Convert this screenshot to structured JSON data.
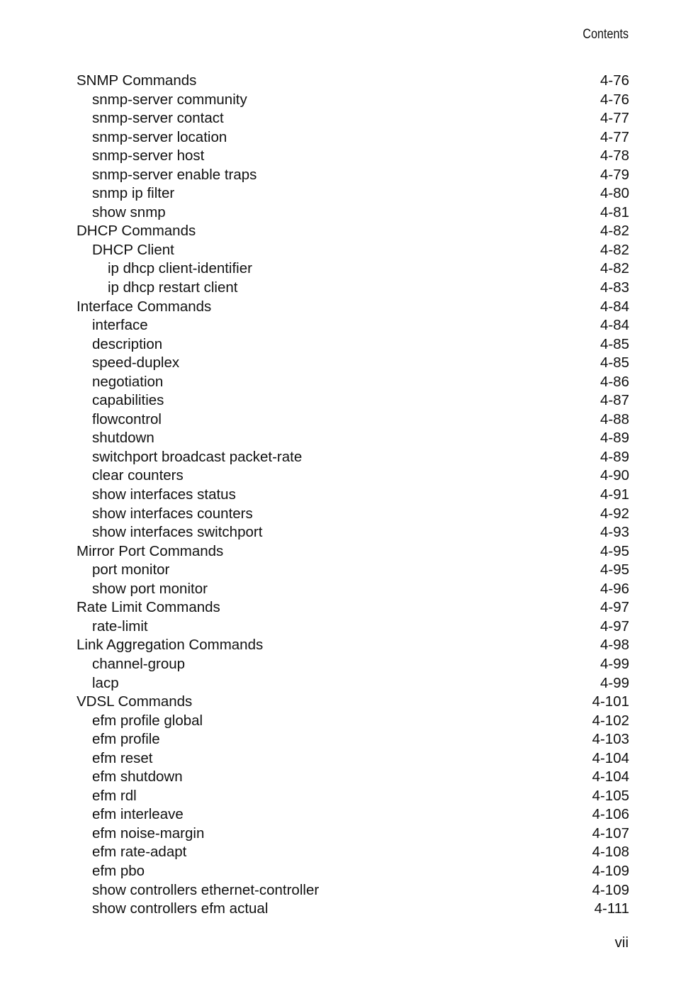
{
  "header": {
    "running_title": "Contents"
  },
  "toc": {
    "entries": [
      {
        "title": "SNMP Commands",
        "page": "4-76",
        "level": 0
      },
      {
        "title": "snmp-server community",
        "page": "4-76",
        "level": 1
      },
      {
        "title": "snmp-server contact",
        "page": "4-77",
        "level": 1
      },
      {
        "title": "snmp-server location",
        "page": "4-77",
        "level": 1
      },
      {
        "title": "snmp-server host",
        "page": "4-78",
        "level": 1
      },
      {
        "title": "snmp-server enable traps",
        "page": "4-79",
        "level": 1
      },
      {
        "title": "snmp ip filter",
        "page": "4-80",
        "level": 1
      },
      {
        "title": "show snmp",
        "page": "4-81",
        "level": 1
      },
      {
        "title": "DHCP Commands",
        "page": "4-82",
        "level": 0
      },
      {
        "title": "DHCP Client",
        "page": "4-82",
        "level": 1
      },
      {
        "title": "ip dhcp client-identifier",
        "page": "4-82",
        "level": 2
      },
      {
        "title": "ip dhcp restart client",
        "page": "4-83",
        "level": 2
      },
      {
        "title": "Interface Commands",
        "page": "4-84",
        "level": 0
      },
      {
        "title": "interface",
        "page": "4-84",
        "level": 1
      },
      {
        "title": "description",
        "page": "4-85",
        "level": 1
      },
      {
        "title": "speed-duplex",
        "page": "4-85",
        "level": 1
      },
      {
        "title": "negotiation",
        "page": "4-86",
        "level": 1
      },
      {
        "title": "capabilities",
        "page": "4-87",
        "level": 1
      },
      {
        "title": "flowcontrol",
        "page": "4-88",
        "level": 1
      },
      {
        "title": "shutdown",
        "page": "4-89",
        "level": 1
      },
      {
        "title": "switchport broadcast packet-rate",
        "page": "4-89",
        "level": 1
      },
      {
        "title": "clear counters",
        "page": "4-90",
        "level": 1
      },
      {
        "title": "show interfaces status",
        "page": "4-91",
        "level": 1
      },
      {
        "title": "show interfaces counters",
        "page": "4-92",
        "level": 1
      },
      {
        "title": "show interfaces switchport",
        "page": "4-93",
        "level": 1
      },
      {
        "title": "Mirror Port Commands",
        "page": "4-95",
        "level": 0
      },
      {
        "title": "port monitor",
        "page": "4-95",
        "level": 1
      },
      {
        "title": "show port monitor",
        "page": "4-96",
        "level": 1
      },
      {
        "title": "Rate Limit Commands",
        "page": "4-97",
        "level": 0
      },
      {
        "title": "rate-limit",
        "page": "4-97",
        "level": 1
      },
      {
        "title": "Link Aggregation Commands",
        "page": "4-98",
        "level": 0
      },
      {
        "title": "channel-group",
        "page": "4-99",
        "level": 1
      },
      {
        "title": "lacp",
        "page": "4-99",
        "level": 1
      },
      {
        "title": "VDSL Commands",
        "page": "4-101",
        "level": 0
      },
      {
        "title": "efm profile global",
        "page": "4-102",
        "level": 1
      },
      {
        "title": "efm profile",
        "page": "4-103",
        "level": 1
      },
      {
        "title": "efm reset",
        "page": "4-104",
        "level": 1
      },
      {
        "title": "efm shutdown",
        "page": "4-104",
        "level": 1
      },
      {
        "title": "efm rdl",
        "page": "4-105",
        "level": 1
      },
      {
        "title": "efm interleave",
        "page": "4-106",
        "level": 1
      },
      {
        "title": "efm noise-margin",
        "page": "4-107",
        "level": 1
      },
      {
        "title": "efm rate-adapt",
        "page": "4-108",
        "level": 1
      },
      {
        "title": "efm pbo",
        "page": "4-109",
        "level": 1
      },
      {
        "title": "show controllers ethernet-controller",
        "page": "4-109",
        "level": 1
      },
      {
        "title": "show controllers efm actual",
        "page": "4-111",
        "level": 1
      }
    ]
  },
  "footer": {
    "page_number": "vii"
  }
}
